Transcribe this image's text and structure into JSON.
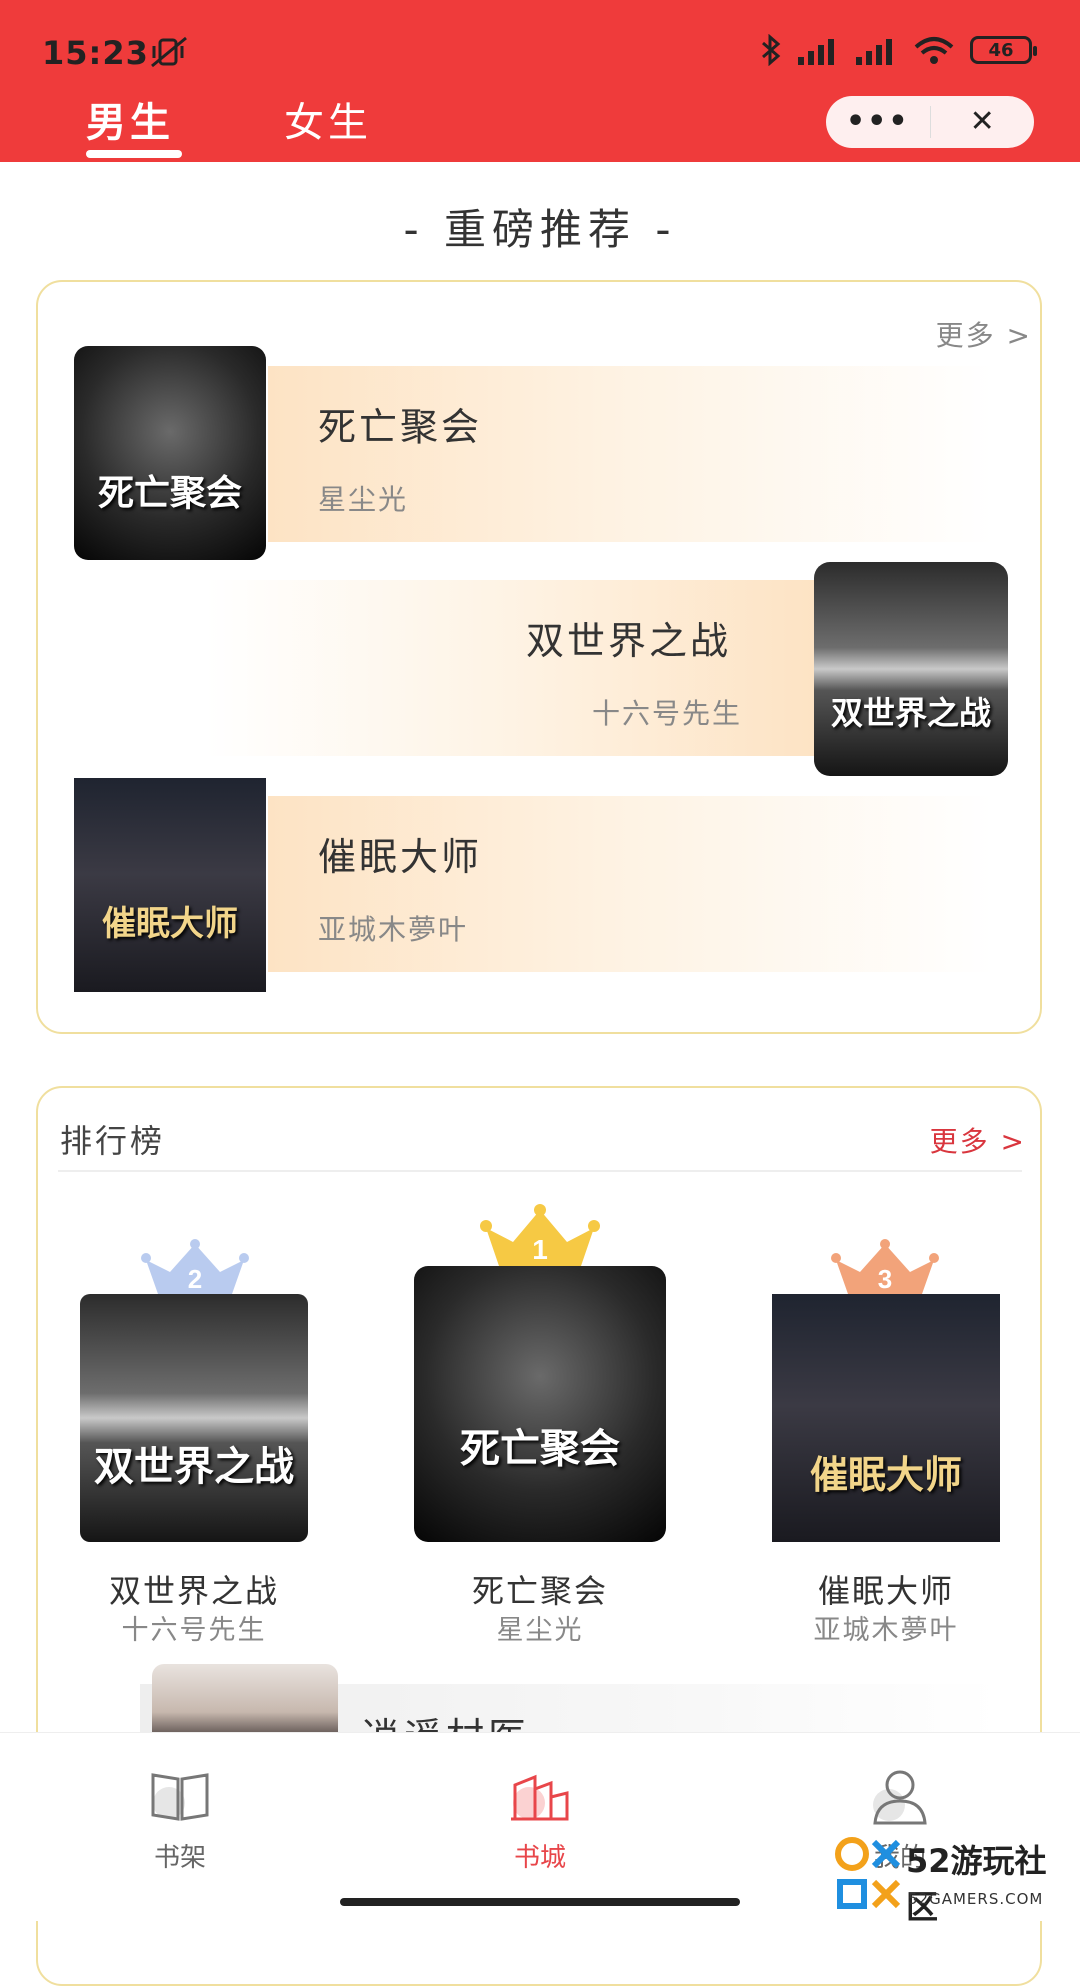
{
  "status_bar": {
    "time": "15:23",
    "battery": "46"
  },
  "tabs": [
    {
      "label": "男生",
      "active": true
    },
    {
      "label": "女生",
      "active": false
    }
  ],
  "section_heading": "- 重磅推荐 -",
  "recommend": {
    "more": "更多 >",
    "books": [
      {
        "title": "死亡聚会",
        "author": "星尘光",
        "cover_text": "死亡聚会"
      },
      {
        "title": "双世界之战",
        "author": "十六号先生",
        "cover_text": "双世界之战"
      },
      {
        "title": "催眠大师",
        "author": "亚城木夢叶",
        "cover_text": "催眠大师"
      }
    ]
  },
  "ranking": {
    "title": "排行榜",
    "more": "更多 >",
    "items": [
      {
        "rank": "2",
        "title": "双世界之战",
        "author": "十六号先生",
        "cover_text": "双世界之战"
      },
      {
        "rank": "1",
        "title": "死亡聚会",
        "author": "星尘光",
        "cover_text": "死亡聚会"
      },
      {
        "rank": "3",
        "title": "催眠大师",
        "author": "亚城木夢叶",
        "cover_text": "催眠大师"
      }
    ],
    "peek_title": "逍遥村医"
  },
  "bottom_nav": [
    {
      "label": "书架",
      "icon": "book-icon",
      "active": false
    },
    {
      "label": "书城",
      "icon": "store-icon",
      "active": true
    },
    {
      "label": "我的",
      "icon": "user-icon",
      "active": false
    }
  ],
  "watermark": {
    "big": "52游玩社区",
    "small": "52GAMERS.COM"
  },
  "colors": {
    "header": "#ef3b3b",
    "accent": "#e8464a",
    "gold": "#f6c944",
    "silver": "#b9cbef",
    "bronze": "#f2a37a"
  }
}
